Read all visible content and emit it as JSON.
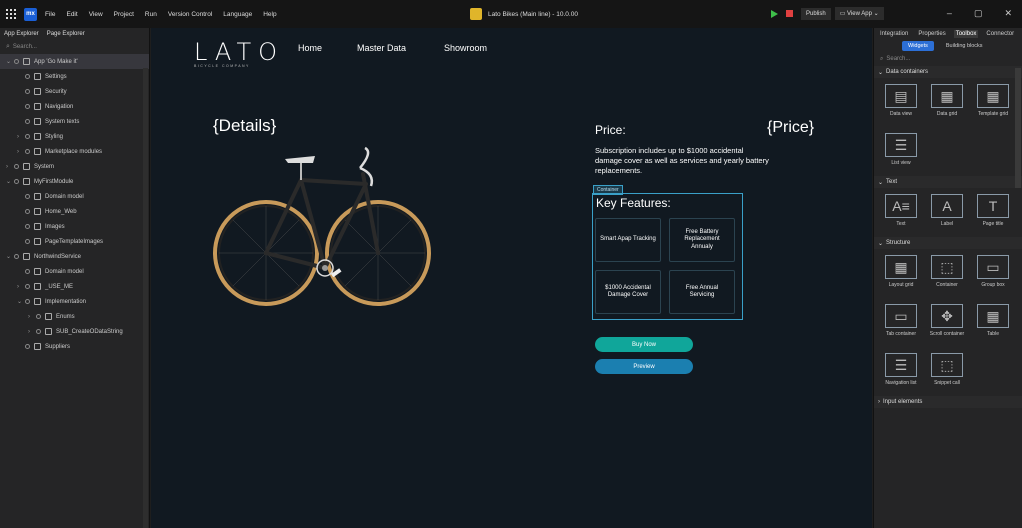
{
  "titlebar": {
    "menu": [
      "File",
      "Edit",
      "View",
      "Project",
      "Run",
      "Version Control",
      "Language",
      "Help"
    ],
    "project": "Lato Bikes (Main line) - 10.0.00",
    "publish": "Publish",
    "view_app": "View App"
  },
  "left": {
    "tabs": [
      "App Explorer",
      "Page Explorer"
    ],
    "search_placeholder": "Search...",
    "tree": [
      {
        "label": "App 'Go Make it'",
        "depth": 0,
        "caret": "⌄",
        "sel": true
      },
      {
        "label": "Settings",
        "depth": 1
      },
      {
        "label": "Security",
        "depth": 1
      },
      {
        "label": "Navigation",
        "depth": 1
      },
      {
        "label": "System texts",
        "depth": 1
      },
      {
        "label": "Styling",
        "depth": 1,
        "caret": "›"
      },
      {
        "label": "Marketplace modules",
        "depth": 1,
        "caret": "›"
      },
      {
        "label": "System",
        "depth": 0,
        "caret": "›"
      },
      {
        "label": "MyFirstModule",
        "depth": 0,
        "caret": "⌄"
      },
      {
        "label": "Domain model",
        "depth": 1
      },
      {
        "label": "Home_Web",
        "depth": 1
      },
      {
        "label": "Images",
        "depth": 1
      },
      {
        "label": "PageTemplateImages",
        "depth": 1
      },
      {
        "label": "NorthwindService",
        "depth": 0,
        "caret": "⌄"
      },
      {
        "label": "Domain model",
        "depth": 1
      },
      {
        "label": "_USE_ME",
        "depth": 1,
        "caret": "›"
      },
      {
        "label": "Implementation",
        "depth": 1,
        "caret": "⌄"
      },
      {
        "label": "Enums",
        "depth": 2,
        "caret": "›"
      },
      {
        "label": "SUB_CreateODataString",
        "depth": 2,
        "caret": "›"
      },
      {
        "label": "Suppliers",
        "depth": 1
      }
    ]
  },
  "canvas": {
    "logo": "LATO",
    "logo_sub": "BICYCLE COMPANY",
    "nav": [
      "Home",
      "Master Data",
      "Showroom"
    ],
    "details": "{Details}",
    "price_label": "Price:",
    "price_value": "{Price}",
    "subscription": "Subscription includes up to $1000 accidental damage cover as well as services and yearly battery replacements.",
    "container_tag": "Container",
    "features_title": "Key Features:",
    "features": [
      "Smart Apap Tracking",
      "Free Battery Replacement Annualy",
      "$1000 Accidental Damage Cover",
      "Free Annual Servicing"
    ],
    "buy": "Buy Now",
    "preview": "Preview",
    "colors": {
      "buy": "#10a69a",
      "preview": "#1b7fb0",
      "container": "#3aa0c8"
    }
  },
  "right": {
    "tabs": [
      "Integration",
      "Properties",
      "Toolbox",
      "Connector"
    ],
    "subtabs": [
      "Widgets",
      "Building blocks"
    ],
    "search_placeholder": "Search...",
    "sections": [
      {
        "title": "Data containers",
        "items": [
          "Data view",
          "Data grid",
          "Template grid",
          "List view"
        ]
      },
      {
        "title": "Text",
        "items": [
          "Text",
          "Label",
          "Page title"
        ]
      },
      {
        "title": "Structure",
        "items": [
          "Layout grid",
          "Container",
          "Group box",
          "Tab container",
          "Scroll container",
          "Table",
          "Navigation list",
          "Snippet call"
        ]
      },
      {
        "title": "Input elements",
        "items": []
      }
    ]
  }
}
